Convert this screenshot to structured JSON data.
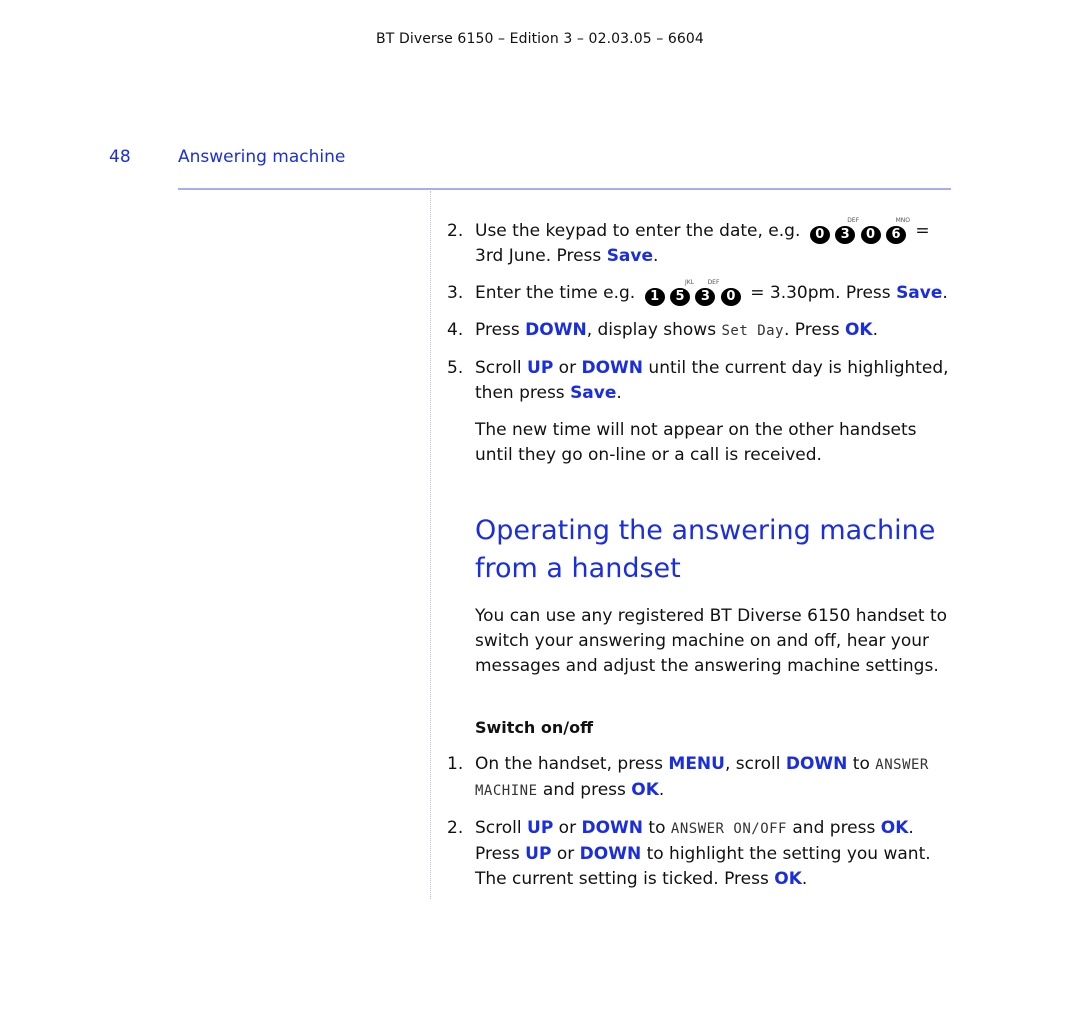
{
  "header": {
    "edition_line": "BT Diverse 6150 – Edition 3 – 02.03.05 – 6604",
    "page_number": "48",
    "section_title": "Answering machine"
  },
  "steps_top": [
    {
      "num": "2.",
      "parts": {
        "a": "Use the keypad to enter the date, e.g.",
        "eq": "=",
        "b": "3rd June. Press ",
        "btn": "Save",
        "end": "."
      },
      "keys": [
        {
          "digit": "0",
          "sup": ""
        },
        {
          "digit": "3",
          "sup": "DEF"
        },
        {
          "digit": "0",
          "sup": ""
        },
        {
          "digit": "6",
          "sup": "MNO"
        }
      ]
    },
    {
      "num": "3.",
      "parts": {
        "a": "Enter the time e.g.",
        "eq": "= 3.30pm. Press",
        "btn": "Save",
        "end": "."
      },
      "keys": [
        {
          "digit": "1",
          "sup": ""
        },
        {
          "digit": "5",
          "sup": "JKL"
        },
        {
          "digit": "3",
          "sup": "DEF"
        },
        {
          "digit": "0",
          "sup": ""
        }
      ]
    },
    {
      "num": "4.",
      "parts": {
        "a": "Press ",
        "btn1": "DOWN",
        "b": ", display shows ",
        "lcd": "Set Day",
        "c": ". Press ",
        "btn2": "OK",
        "end": "."
      }
    },
    {
      "num": "5.",
      "parts": {
        "a": "Scroll ",
        "btn1": "UP",
        "b": " or ",
        "btn2": "DOWN",
        "c": " until the current day is highlighted, then press ",
        "btn3": "Save",
        "end": "."
      }
    }
  ],
  "note": "The new time will not appear on the other handsets until they go on-line or a call is received.",
  "section": {
    "heading": "Operating the answering machine from a handset",
    "intro": "You can use any registered BT Diverse 6150 handset to switch your answering machine on and off, hear your messages and adjust the answering machine settings.",
    "subheading": "Switch on/off"
  },
  "steps_bottom": [
    {
      "num": "1.",
      "parts": {
        "a": "On the handset, press ",
        "btn1": "MENU",
        "b": ", scroll ",
        "btn2": "DOWN",
        "c": " to ",
        "lcd": "ANSWER MACHINE",
        "d": " and press ",
        "btn3": "OK",
        "end": "."
      }
    },
    {
      "num": "2.",
      "parts": {
        "a": "Scroll ",
        "btn1": "UP",
        "b": " or ",
        "btn2": "DOWN",
        "c": " to ",
        "lcd": "ANSWER ON/OFF",
        "d": " and press ",
        "btn3": "OK",
        "e": ". Press ",
        "btn4": "UP",
        "f": " or ",
        "btn5": "DOWN",
        "g": " to highlight the setting you want. The current setting is ticked. Press ",
        "btn6": "OK",
        "end": "."
      }
    }
  ],
  "colors": {
    "accent": "#1a2ee0",
    "rule": "#a9adf0",
    "text": "#111111"
  }
}
